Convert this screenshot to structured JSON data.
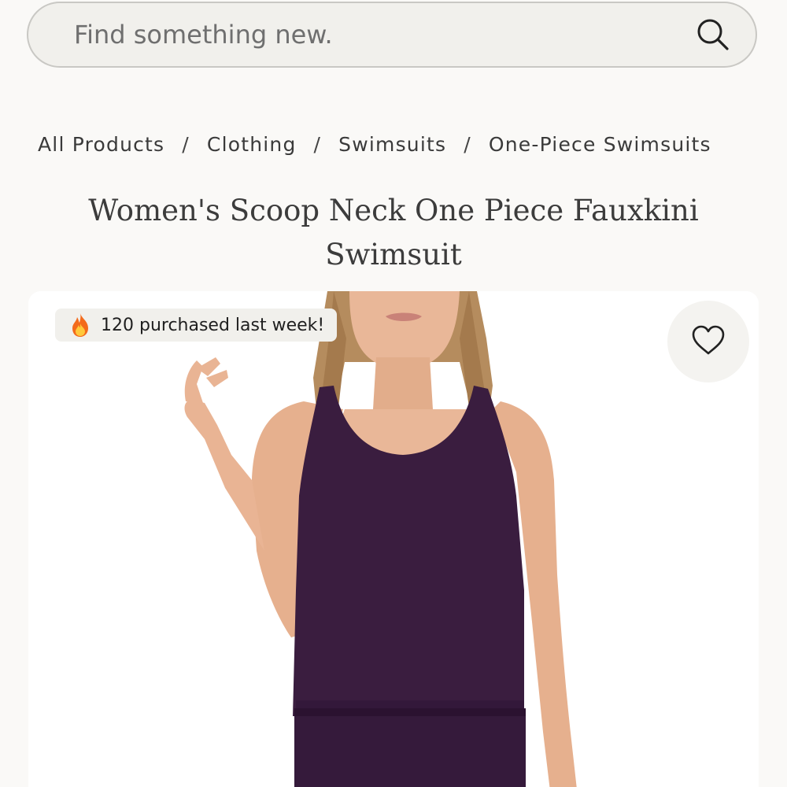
{
  "search": {
    "placeholder": "Find something new."
  },
  "breadcrumb": {
    "items": [
      {
        "label": "All Products"
      },
      {
        "label": "Clothing"
      },
      {
        "label": "Swimsuits"
      },
      {
        "label": "One-Piece Swimsuits"
      }
    ],
    "separator": "/"
  },
  "product": {
    "title": "Women's Scoop Neck One Piece Fauxkini Swimsuit",
    "badge_text": "120 purchased last week!",
    "badge_icon": "fire-icon",
    "favorite_icon": "heart-icon",
    "garment_color": "#3a1d3f"
  },
  "colors": {
    "background": "#faf9f7",
    "search_bg": "#f1f0ec",
    "text": "#3a3a3a"
  }
}
